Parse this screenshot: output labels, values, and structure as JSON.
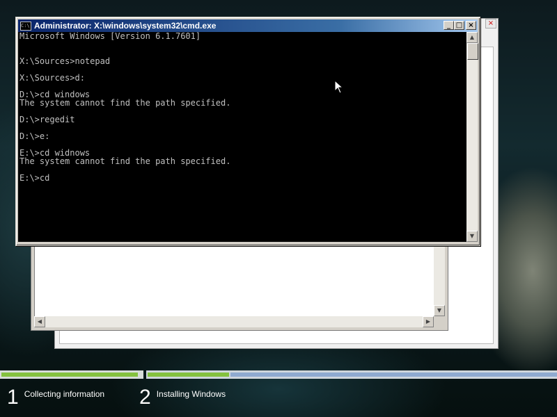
{
  "cmd_window": {
    "title": "Administrator: X:\\windows\\system32\\cmd.exe",
    "icon": "cmd-icon",
    "buttons": {
      "minimize": "_",
      "maximize": "□",
      "close": "×"
    },
    "console_lines": [
      "Microsoft Windows [Version 6.1.7601]",
      "",
      "",
      "X:\\Sources>notepad",
      "",
      "X:\\Sources>d:",
      "",
      "D:\\>cd windows",
      "The system cannot find the path specified.",
      "",
      "D:\\>regedit",
      "",
      "D:\\>e:",
      "",
      "E:\\>cd widnows",
      "The system cannot find the path specified.",
      "",
      "E:\\>cd"
    ]
  },
  "setup": {
    "progress": [
      0.97,
      0.2
    ],
    "steps": [
      {
        "number": "1",
        "label": "Collecting information"
      },
      {
        "number": "2",
        "label": "Installing Windows"
      }
    ]
  },
  "colors": {
    "titlebar": "#0a246a",
    "progress_fill": "#84c13f",
    "progress_remaining": "#8faad0"
  }
}
